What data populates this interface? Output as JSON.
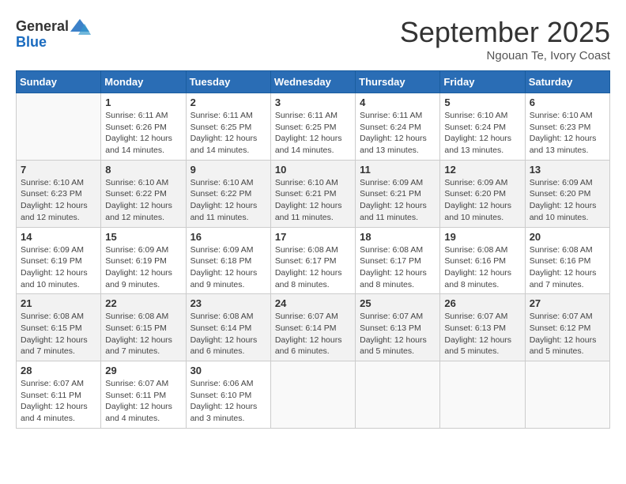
{
  "logo": {
    "general": "General",
    "blue": "Blue"
  },
  "header": {
    "month": "September 2025",
    "location": "Ngouan Te, Ivory Coast"
  },
  "weekdays": [
    "Sunday",
    "Monday",
    "Tuesday",
    "Wednesday",
    "Thursday",
    "Friday",
    "Saturday"
  ],
  "weeks": [
    [
      {
        "day": "",
        "info": ""
      },
      {
        "day": "1",
        "info": "Sunrise: 6:11 AM\nSunset: 6:26 PM\nDaylight: 12 hours\nand 14 minutes."
      },
      {
        "day": "2",
        "info": "Sunrise: 6:11 AM\nSunset: 6:25 PM\nDaylight: 12 hours\nand 14 minutes."
      },
      {
        "day": "3",
        "info": "Sunrise: 6:11 AM\nSunset: 6:25 PM\nDaylight: 12 hours\nand 14 minutes."
      },
      {
        "day": "4",
        "info": "Sunrise: 6:11 AM\nSunset: 6:24 PM\nDaylight: 12 hours\nand 13 minutes."
      },
      {
        "day": "5",
        "info": "Sunrise: 6:10 AM\nSunset: 6:24 PM\nDaylight: 12 hours\nand 13 minutes."
      },
      {
        "day": "6",
        "info": "Sunrise: 6:10 AM\nSunset: 6:23 PM\nDaylight: 12 hours\nand 13 minutes."
      }
    ],
    [
      {
        "day": "7",
        "info": "Sunrise: 6:10 AM\nSunset: 6:23 PM\nDaylight: 12 hours\nand 12 minutes."
      },
      {
        "day": "8",
        "info": "Sunrise: 6:10 AM\nSunset: 6:22 PM\nDaylight: 12 hours\nand 12 minutes."
      },
      {
        "day": "9",
        "info": "Sunrise: 6:10 AM\nSunset: 6:22 PM\nDaylight: 12 hours\nand 11 minutes."
      },
      {
        "day": "10",
        "info": "Sunrise: 6:10 AM\nSunset: 6:21 PM\nDaylight: 12 hours\nand 11 minutes."
      },
      {
        "day": "11",
        "info": "Sunrise: 6:09 AM\nSunset: 6:21 PM\nDaylight: 12 hours\nand 11 minutes."
      },
      {
        "day": "12",
        "info": "Sunrise: 6:09 AM\nSunset: 6:20 PM\nDaylight: 12 hours\nand 10 minutes."
      },
      {
        "day": "13",
        "info": "Sunrise: 6:09 AM\nSunset: 6:20 PM\nDaylight: 12 hours\nand 10 minutes."
      }
    ],
    [
      {
        "day": "14",
        "info": "Sunrise: 6:09 AM\nSunset: 6:19 PM\nDaylight: 12 hours\nand 10 minutes."
      },
      {
        "day": "15",
        "info": "Sunrise: 6:09 AM\nSunset: 6:19 PM\nDaylight: 12 hours\nand 9 minutes."
      },
      {
        "day": "16",
        "info": "Sunrise: 6:09 AM\nSunset: 6:18 PM\nDaylight: 12 hours\nand 9 minutes."
      },
      {
        "day": "17",
        "info": "Sunrise: 6:08 AM\nSunset: 6:17 PM\nDaylight: 12 hours\nand 8 minutes."
      },
      {
        "day": "18",
        "info": "Sunrise: 6:08 AM\nSunset: 6:17 PM\nDaylight: 12 hours\nand 8 minutes."
      },
      {
        "day": "19",
        "info": "Sunrise: 6:08 AM\nSunset: 6:16 PM\nDaylight: 12 hours\nand 8 minutes."
      },
      {
        "day": "20",
        "info": "Sunrise: 6:08 AM\nSunset: 6:16 PM\nDaylight: 12 hours\nand 7 minutes."
      }
    ],
    [
      {
        "day": "21",
        "info": "Sunrise: 6:08 AM\nSunset: 6:15 PM\nDaylight: 12 hours\nand 7 minutes."
      },
      {
        "day": "22",
        "info": "Sunrise: 6:08 AM\nSunset: 6:15 PM\nDaylight: 12 hours\nand 7 minutes."
      },
      {
        "day": "23",
        "info": "Sunrise: 6:08 AM\nSunset: 6:14 PM\nDaylight: 12 hours\nand 6 minutes."
      },
      {
        "day": "24",
        "info": "Sunrise: 6:07 AM\nSunset: 6:14 PM\nDaylight: 12 hours\nand 6 minutes."
      },
      {
        "day": "25",
        "info": "Sunrise: 6:07 AM\nSunset: 6:13 PM\nDaylight: 12 hours\nand 5 minutes."
      },
      {
        "day": "26",
        "info": "Sunrise: 6:07 AM\nSunset: 6:13 PM\nDaylight: 12 hours\nand 5 minutes."
      },
      {
        "day": "27",
        "info": "Sunrise: 6:07 AM\nSunset: 6:12 PM\nDaylight: 12 hours\nand 5 minutes."
      }
    ],
    [
      {
        "day": "28",
        "info": "Sunrise: 6:07 AM\nSunset: 6:11 PM\nDaylight: 12 hours\nand 4 minutes."
      },
      {
        "day": "29",
        "info": "Sunrise: 6:07 AM\nSunset: 6:11 PM\nDaylight: 12 hours\nand 4 minutes."
      },
      {
        "day": "30",
        "info": "Sunrise: 6:06 AM\nSunset: 6:10 PM\nDaylight: 12 hours\nand 3 minutes."
      },
      {
        "day": "",
        "info": ""
      },
      {
        "day": "",
        "info": ""
      },
      {
        "day": "",
        "info": ""
      },
      {
        "day": "",
        "info": ""
      }
    ]
  ]
}
